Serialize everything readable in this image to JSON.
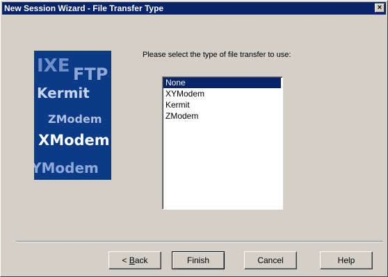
{
  "window": {
    "title": "New Session Wizard - File Transfer Type",
    "close_glyph": "×"
  },
  "banner": {
    "words": [
      "IXE",
      "FTP",
      "Kermit",
      "ZModem",
      "XModem",
      "YModem"
    ],
    "background": "#0b3a87"
  },
  "prompt": "Please select the type of file transfer to use:",
  "list": {
    "items": [
      "None",
      "XYModem",
      "Kermit",
      "ZModem"
    ],
    "selected": "None"
  },
  "buttons": {
    "back_arrow": "< ",
    "back_mnemonic": "B",
    "back_rest": "ack",
    "finish": "Finish",
    "cancel": "Cancel",
    "help": "Help"
  },
  "colors": {
    "titlebar": "#0a246a",
    "face": "#d4d0c8",
    "selection": "#0a246a"
  }
}
